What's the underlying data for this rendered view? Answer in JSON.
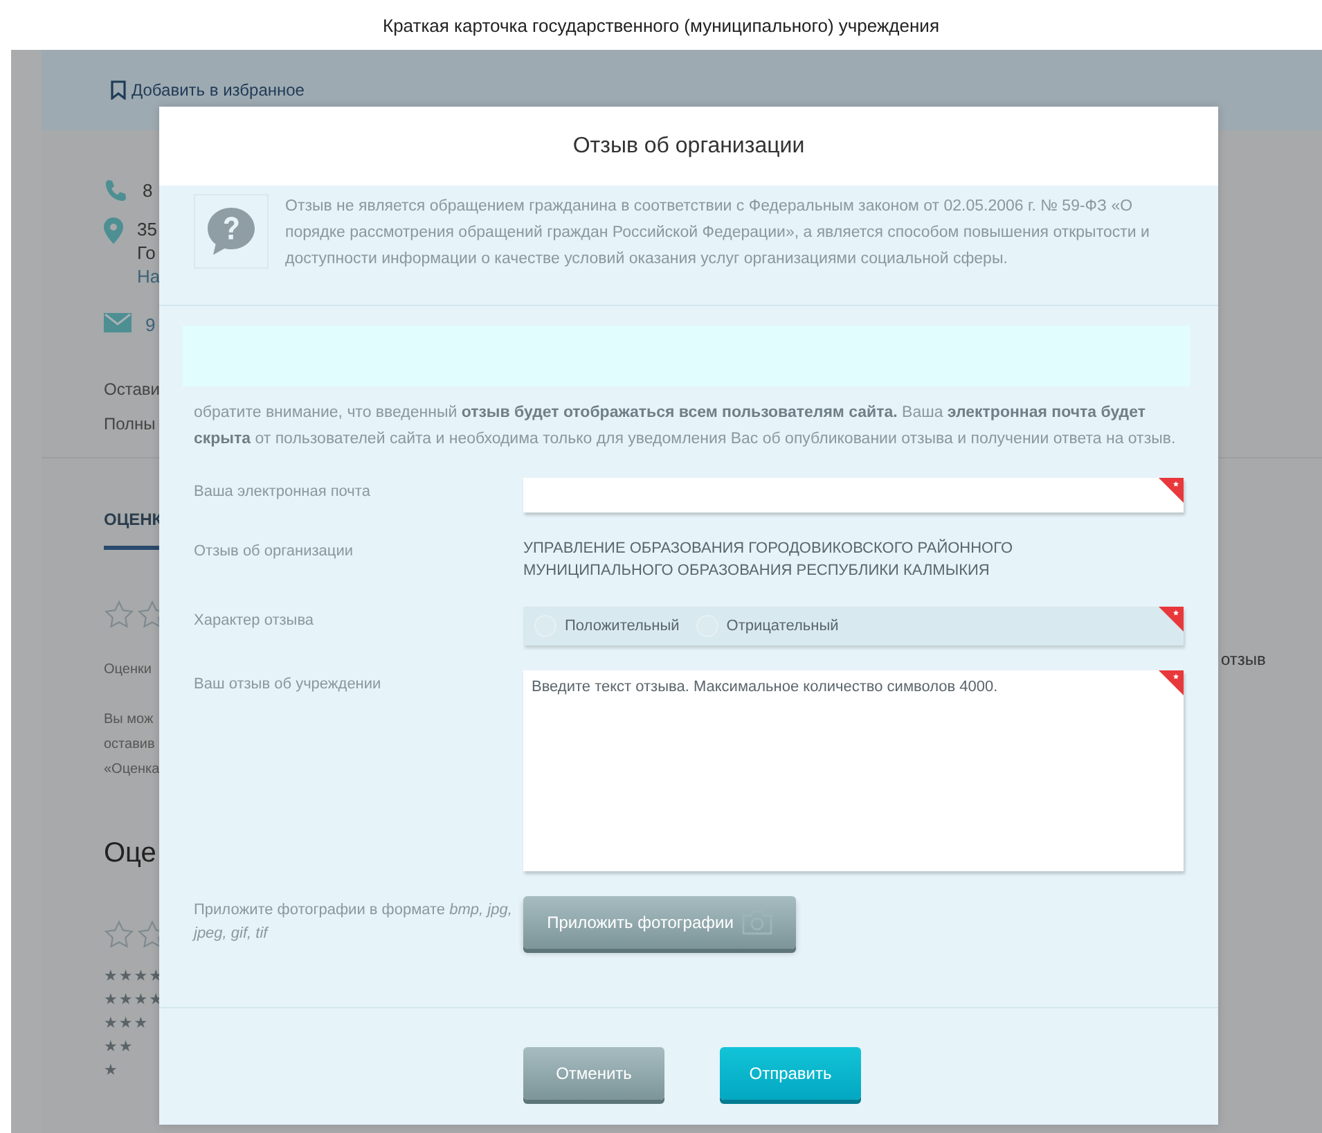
{
  "page_title": "Краткая карточка государственного (муниципального) учреждения",
  "background": {
    "favorite_link": "Добавить в избранное",
    "phone": "8",
    "address_lines": [
      "35",
      "Го",
      "На"
    ],
    "email": "9",
    "links": [
      "Остави",
      "Полны"
    ],
    "tab": "ОЦЕНК",
    "ratings_note": "Оценки",
    "info_lines": [
      "Вы мож",
      "оставив",
      "«Оценка"
    ],
    "section_title": "Оце",
    "histogram": [
      {
        "label": "★★★★"
      },
      {
        "label": "★★★★"
      },
      {
        "label": "★★★"
      },
      {
        "label": "★★"
      },
      {
        "label": "★"
      }
    ],
    "side_text": "отзыв"
  },
  "modal": {
    "title": "Отзыв об организации",
    "notice": "Отзыв не является обращением гражданина в соответствии с Федеральным законом от 02.05.2006 г. № 59-ФЗ «О порядке рассмотрения обращений граждан Российской Федерации», а является способом повышения открытости и доступности информации о качестве условий оказания услуг организациями социальной сферы.",
    "privacy_note": "обратите внимание, что введенный **отзыв будет отображаться всем пользователям сайта.** Ваша **электронная почта будет скрыта** от пользователей сайта и необходима только для уведомления Вас об опубликовании отзыва и получении ответа на отзыв.",
    "fields": [
      {
        "kind": "input",
        "label": "Ваша электронная почта",
        "required": true
      },
      {
        "kind": "text",
        "label": "Отзыв об организации",
        "value": "УПРАВЛЕНИЕ ОБРАЗОВАНИЯ ГОРОДОВИКОВСКОГО РАЙОННОГО МУНИЦИПАЛЬНОГО ОБРАЗОВАНИЯ РЕСПУБЛИКИ КАЛМЫКИЯ"
      },
      {
        "kind": "radio",
        "label": "Характер отзыва",
        "required": true,
        "options": [
          {
            "label": "Положительный",
            "selected": false
          },
          {
            "label": "Отрицательный",
            "selected": false
          }
        ]
      },
      {
        "kind": "textarea",
        "label": "Ваш отзыв об учреждении",
        "placeholder": "Введите текст отзыва. Максимальное количество символов 4000.",
        "required": true
      },
      {
        "kind": "upload",
        "label": "Приложите фотографии в формате *bmp, jpg, jpeg, gif, tif*",
        "button": "Приложить фотографии"
      }
    ],
    "buttons": [
      {
        "label": "Отменить",
        "kind": "secondary"
      },
      {
        "label": "Отправить",
        "kind": "primary"
      }
    ]
  }
}
